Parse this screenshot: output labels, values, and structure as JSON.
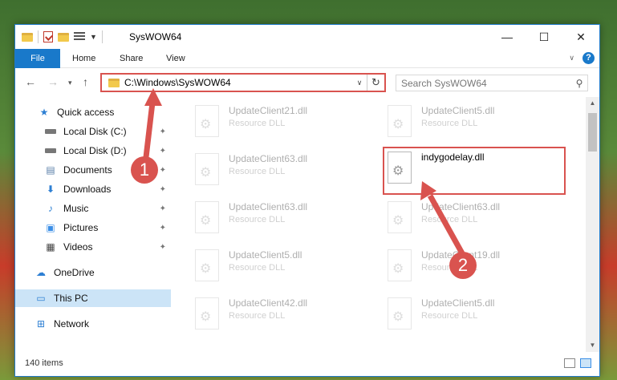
{
  "window": {
    "title": "SysWOW64",
    "controls": {
      "minimize": "—",
      "maximize": "☐",
      "close": "✕"
    }
  },
  "ribbon": {
    "tabs": [
      "File",
      "Home",
      "Share",
      "View"
    ],
    "help_label": "?"
  },
  "navigation": {
    "address": "C:\\Windows\\SysWOW64",
    "search_placeholder": "Search SysWOW64"
  },
  "sidebar": {
    "items": [
      {
        "label": "Quick access",
        "icon": "star-icon"
      },
      {
        "label": "Local Disk (C:)",
        "icon": "drive-icon",
        "pinned": true
      },
      {
        "label": "Local Disk (D:)",
        "icon": "drive-icon",
        "pinned": true
      },
      {
        "label": "Documents",
        "icon": "documents-icon",
        "pinned": true
      },
      {
        "label": "Downloads",
        "icon": "download-icon",
        "pinned": true
      },
      {
        "label": "Music",
        "icon": "music-icon",
        "pinned": true
      },
      {
        "label": "Pictures",
        "icon": "pictures-icon",
        "pinned": true
      },
      {
        "label": "Videos",
        "icon": "videos-icon",
        "pinned": true
      },
      {
        "label": "OneDrive",
        "icon": "cloud-icon"
      },
      {
        "label": "This PC",
        "icon": "computer-icon",
        "selected": true
      },
      {
        "label": "Network",
        "icon": "network-icon"
      }
    ]
  },
  "files": [
    {
      "name": "UpdateClient21.dll",
      "desc": "Resource DLL",
      "faded": true
    },
    {
      "name": "UpdateClient5.dll",
      "desc": "Resource DLL",
      "faded": true
    },
    {
      "name": "UpdateClient63.dll",
      "desc": "Resource DLL",
      "faded": true
    },
    {
      "name": "indygodelay.dll",
      "desc": "",
      "faded": false
    },
    {
      "name": "UpdateClient63.dll",
      "desc": "Resource DLL",
      "faded": true
    },
    {
      "name": "UpdateClient63.dll",
      "desc": "Resource DLL",
      "faded": true
    },
    {
      "name": "UpdateClient5.dll",
      "desc": "Resource DLL",
      "faded": true
    },
    {
      "name": "UpdateClient19.dll",
      "desc": "Resource DLL",
      "faded": true
    },
    {
      "name": "UpdateClient42.dll",
      "desc": "Resource DLL",
      "faded": true
    },
    {
      "name": "UpdateClient5.dll",
      "desc": "Resource DLL",
      "faded": true
    }
  ],
  "status": {
    "item_count": "140 items"
  },
  "annotations": {
    "step1": "1",
    "step2": "2",
    "color": "#d9534f"
  }
}
